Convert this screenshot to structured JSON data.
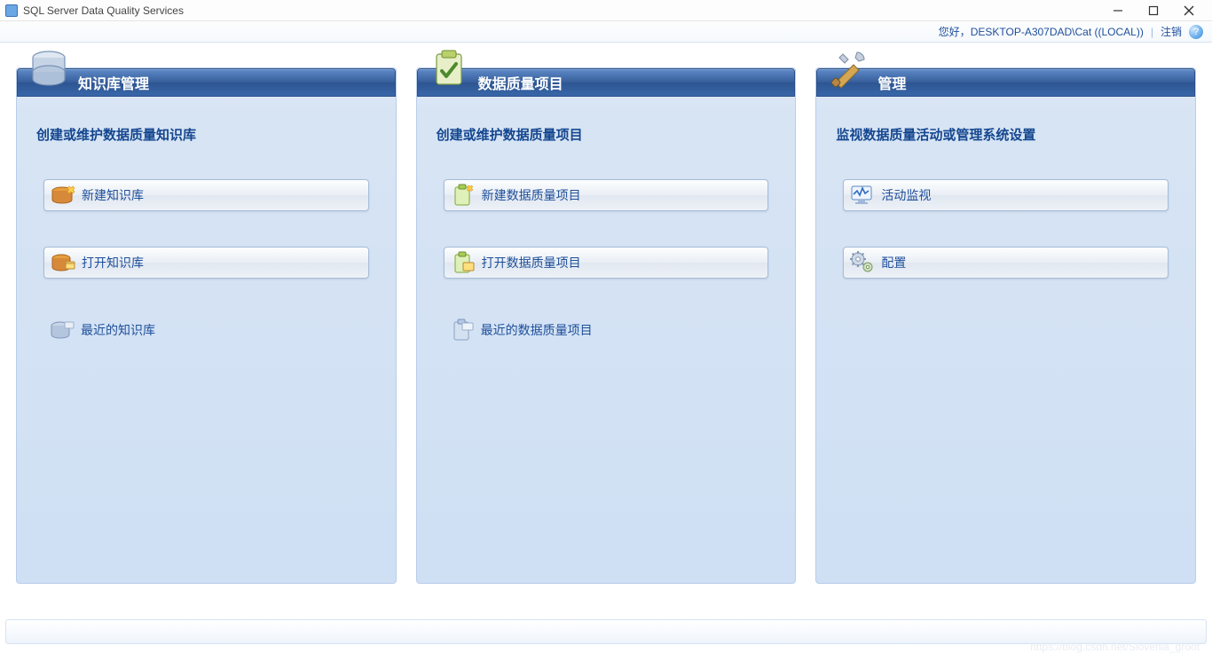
{
  "window": {
    "title": "SQL Server Data Quality Services"
  },
  "header": {
    "greeting_prefix": "您好，",
    "user": "DESKTOP-A307DAD\\Cat ((LOCAL))",
    "logout": "注销"
  },
  "cards": {
    "kb": {
      "title": "知识库管理",
      "desc": "创建或维护数据质量知识库",
      "new": "新建知识库",
      "open": "打开知识库",
      "recent": "最近的知识库"
    },
    "dq": {
      "title": "数据质量项目",
      "desc": "创建或维护数据质量项目",
      "new": "新建数据质量项目",
      "open": "打开数据质量项目",
      "recent": "最近的数据质量项目"
    },
    "admin": {
      "title": "管理",
      "desc": "监视数据质量活动或管理系统设置",
      "activity": "活动监视",
      "config": "配置"
    }
  },
  "watermark": "https://blog.csdn.net/Slovenia_groot"
}
